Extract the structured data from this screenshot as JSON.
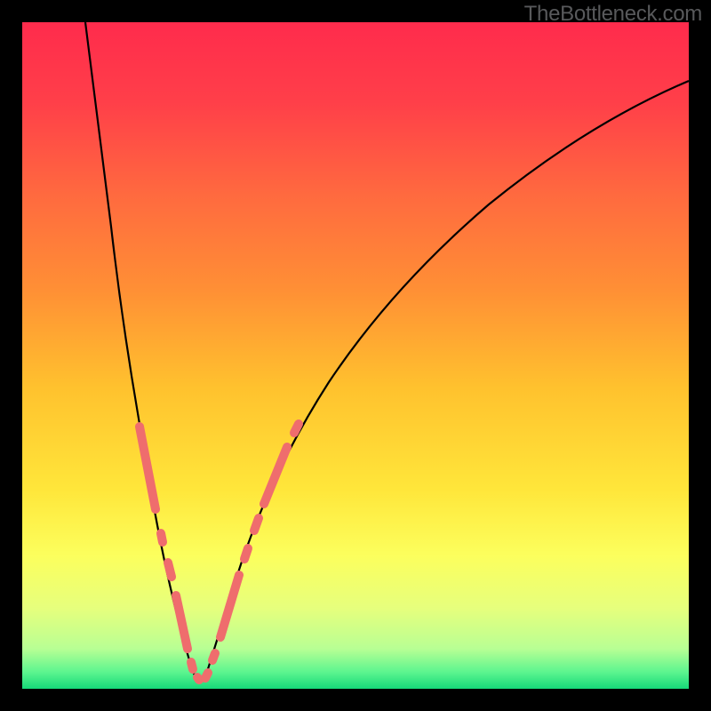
{
  "watermark": "TheBottleneck.com",
  "chart_data": {
    "type": "line",
    "title": "",
    "xlabel": "",
    "ylabel": "",
    "xlim": [
      0,
      100
    ],
    "ylim": [
      0,
      100
    ],
    "grid": false,
    "curve_left": {
      "description": "Steep descending curve from top-left toward minimum",
      "points_normalized": [
        [
          0.095,
          0.0
        ],
        [
          0.105,
          0.1
        ],
        [
          0.117,
          0.2
        ],
        [
          0.13,
          0.3
        ],
        [
          0.144,
          0.4
        ],
        [
          0.158,
          0.5
        ],
        [
          0.172,
          0.6
        ],
        [
          0.188,
          0.7
        ],
        [
          0.206,
          0.8
        ],
        [
          0.226,
          0.9
        ],
        [
          0.246,
          0.98
        ]
      ]
    },
    "curve_right": {
      "description": "Ascending curve from minimum toward upper right with decreasing slope",
      "points_normalized": [
        [
          0.268,
          0.98
        ],
        [
          0.29,
          0.9
        ],
        [
          0.32,
          0.8
        ],
        [
          0.36,
          0.7
        ],
        [
          0.415,
          0.6
        ],
        [
          0.485,
          0.5
        ],
        [
          0.57,
          0.4
        ],
        [
          0.675,
          0.3
        ],
        [
          0.8,
          0.2
        ],
        [
          0.94,
          0.12
        ],
        [
          1.0,
          0.09
        ]
      ]
    },
    "minimum_region_x_normalized": [
      0.235,
      0.28
    ],
    "markers": {
      "description": "Salmon-colored rounded data-point clusters along both curves in lower third",
      "left_branch_y_normalized": [
        0.68,
        0.84
      ],
      "right_branch_y_normalized": [
        0.72,
        0.9
      ],
      "near_minimum": true
    },
    "background_gradient": {
      "type": "vertical",
      "stops": [
        {
          "offset": 0.0,
          "color": "#ff2b4c"
        },
        {
          "offset": 0.12,
          "color": "#ff3f49"
        },
        {
          "offset": 0.26,
          "color": "#ff6a3f"
        },
        {
          "offset": 0.4,
          "color": "#ff8f35"
        },
        {
          "offset": 0.55,
          "color": "#ffc22e"
        },
        {
          "offset": 0.7,
          "color": "#ffe63a"
        },
        {
          "offset": 0.8,
          "color": "#fcff5d"
        },
        {
          "offset": 0.88,
          "color": "#e6ff7d"
        },
        {
          "offset": 0.94,
          "color": "#b8ff94"
        },
        {
          "offset": 0.975,
          "color": "#5cf58f"
        },
        {
          "offset": 1.0,
          "color": "#16d979"
        }
      ]
    }
  }
}
